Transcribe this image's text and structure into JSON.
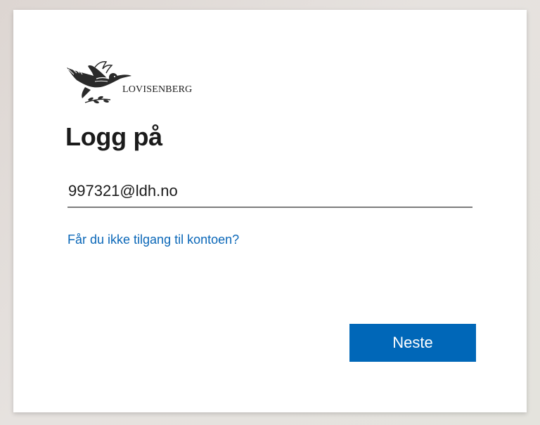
{
  "brand": {
    "name": "LOVISENBERG",
    "logo_icon": "dove-with-olive-branch-icon"
  },
  "signin": {
    "title": "Logg på",
    "email_value": "997321@ldh.no",
    "help_link": "Får du ikke tilgang til kontoen?",
    "next_label": "Neste"
  },
  "colors": {
    "accent": "#0067b8",
    "link": "#0a67b8",
    "text": "#1b1b1b",
    "card": "#ffffff"
  }
}
